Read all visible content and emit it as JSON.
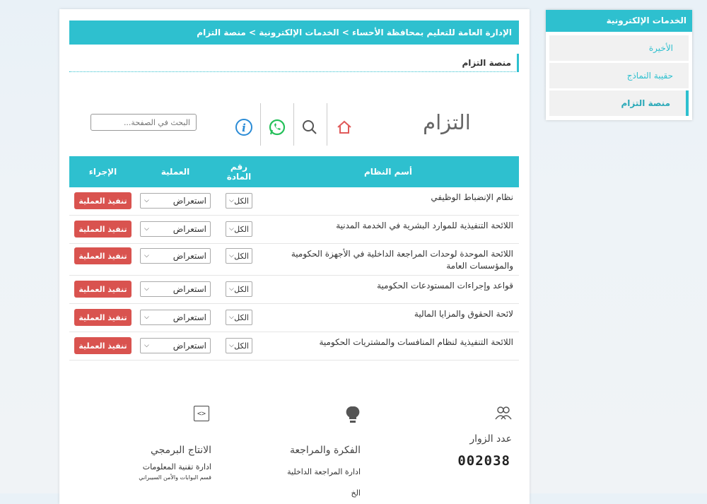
{
  "breadcrumb": "الإدارة العامة للتعليم بمحافظة الأحساء > الخدمات الإلكترونية > منصة التزام",
  "page_heading": "منصة التزام",
  "brand_title": "التزام",
  "search": {
    "placeholder": "البحث في الصفحة..."
  },
  "toolbar": {
    "icons": [
      "home-icon",
      "search-icon",
      "whatsapp-icon",
      "info-icon"
    ],
    "colors": {
      "home": "#e05a5a",
      "whatsapp": "#25c05a",
      "info": "#2a8bd6",
      "search": "#555555"
    }
  },
  "table": {
    "headers": {
      "name": "أسم النظام",
      "article": "رقم المادة",
      "operation": "العملية",
      "action": "الإجراء"
    },
    "rows": [
      {
        "name": "نظام الإنضباط الوظيفي",
        "article": "الكل",
        "operation": "استعراض",
        "action": "تنفيذ العملية"
      },
      {
        "name": "اللائحة التنفيذية للموارد البشرية في الخدمة المدنية",
        "article": "الكل",
        "operation": "استعراض",
        "action": "تنفيذ العملية"
      },
      {
        "name": "اللائحة الموحدة لوحدات المراجعة الداخلية في الأجهزة الحكومية والمؤسسات العامة",
        "article": "الكل",
        "operation": "استعراض",
        "action": "تنفيذ العملية"
      },
      {
        "name": "قواعد وإجراءات المستودعات الحكومية",
        "article": "الكل",
        "operation": "استعراض",
        "action": "تنفيذ العملية"
      },
      {
        "name": "لائحة الحقوق والمزايا المالية",
        "article": "الكل",
        "operation": "استعراض",
        "action": "تنفيذ العملية"
      },
      {
        "name": "اللائحة التنفيذية لنظام المنافسات والمشتريات الحكومية",
        "article": "الكل",
        "operation": "استعراض",
        "action": "تنفيذ العملية"
      }
    ]
  },
  "footer": {
    "visitors": {
      "title": "عدد الزوار",
      "count": "002038"
    },
    "idea": {
      "title": "الفكرة والمراجعة",
      "sub": "ادارة المراجعة الداخلية",
      "extra": "الخ"
    },
    "dev": {
      "title": "الانتاج البرمجي",
      "sub": "ادارة تقنية المعلومات",
      "small": "قسم البوابات والأمن السيبراني"
    }
  },
  "sidebar": {
    "title": "الخدمات الإلكترونية",
    "items": [
      {
        "label": "الأخيرة",
        "active": false
      },
      {
        "label": "حقيبة النماذج",
        "active": false
      },
      {
        "label": "منصة التزام",
        "active": true
      }
    ]
  },
  "colors": {
    "accent": "#2ec0cf",
    "danger": "#d9534f"
  }
}
